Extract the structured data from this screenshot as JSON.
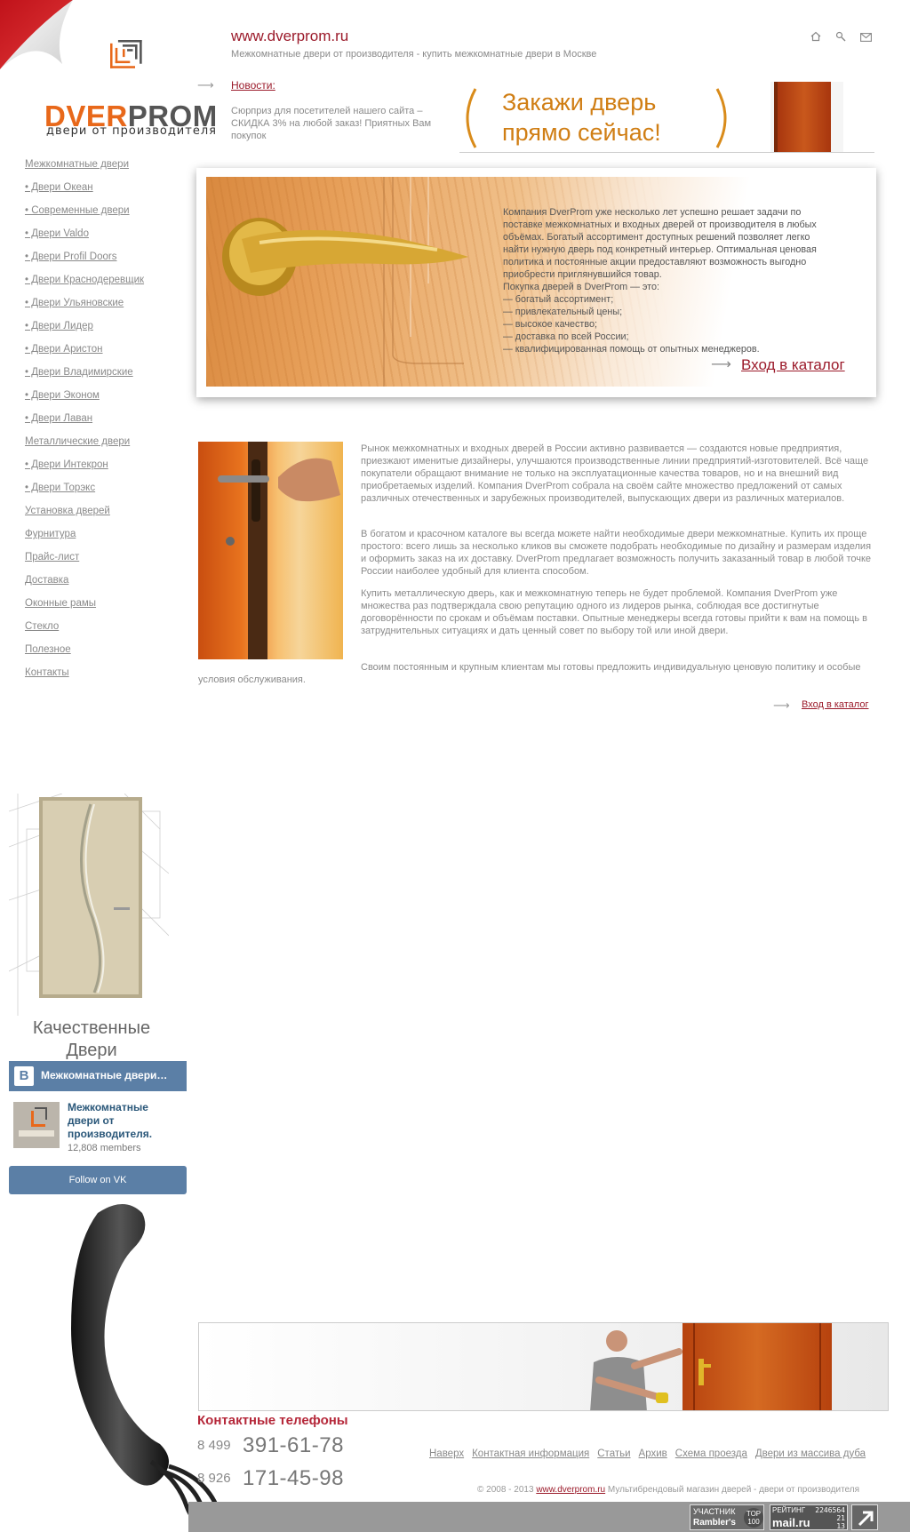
{
  "header": {
    "site_url": "www.dverprom.ru",
    "tagline": "Межкомнатные двери от производителя - купить межкомнатные двери в Москве",
    "icons": [
      "home-icon",
      "search-icon",
      "mail-icon"
    ]
  },
  "logo": {
    "brand_prefix": "DVER",
    "brand_suffix": "PROM",
    "subtitle": "двери от производителя",
    "accent_color": "#e8681a"
  },
  "news": {
    "arrow": "⟶",
    "link_label": "Новости:",
    "text": "Сюрприз для посетителей нашего сайта – СКИДКА 3% на любой заказ! Приятных Вам покупок"
  },
  "banner_top": {
    "line1": "Закажи дверь",
    "line2": "прямо сейчас!"
  },
  "left_nav": [
    "Межкомнатные двери",
    "• Двери Океан",
    "• Современные двери",
    "• Двери Valdo",
    "• Двери Profil Doors",
    "• Двери Краснодеревщик",
    "• Двери Ульяновские",
    "• Двери Лидер",
    "• Двери Аристон",
    "• Двери Владимирские",
    "• Двери Эконом",
    "• Двери Лаван",
    "Металлические двери",
    "• Двери Интекрон",
    "• Двери Торэкс",
    "Установка дверей",
    "Фурнитура",
    "Прайс-лист",
    "Доставка",
    "Оконные рамы",
    "Стекло",
    "Полезное",
    "Контакты"
  ],
  "hero": {
    "lines": [
      "Компания DverProm уже несколько лет успешно решает задачи по",
      "поставке межкомнатных и входных дверей от производителя в любых",
      "объёмах. Богатый ассортимент доступных решений позволяет легко",
      "найти нужную дверь под конкретный интерьер. Оптимальная ценовая",
      "политика и постоянные акции предоставляют возможность выгодно",
      "приобрести приглянувшийся товар.",
      "Покупка дверей в DverProm — это:",
      "— богатый ассортимент;",
      "— привлекательный цены;",
      "— высокое качество;",
      "— доставка по всей России;",
      "— квалифицированная помощь от опытных менеджеров."
    ],
    "cta_arrow": "⟶",
    "cta_label": "Вход в каталог"
  },
  "article": {
    "p1": "Рынок межкомнатных и входных дверей в России активно развивается — создаются новые предприятия, приезжают именитые дизайнеры, улучшаются производственные линии предприятий-изготовителей. Всё чаще покупатели обращают внимание не только на эксплуатационные качества товаров, но и на внешний вид приобретаемых изделий. Компания DverProm собрала на своём сайте множество предложений от самых различных отечественных и зарубежных производителей, выпускающих двери из различных материалов.",
    "p2": "В богатом и красочном каталоге вы всегда можете найти необходимые двери межкомнатные. Купить их проще простого: всего лишь за несколько кликов вы сможете подобрать необходимые по дизайну и размерам изделия и оформить заказ на их доставку. DverProm предлагает возможность получить заказанный товар в любой точке России наиболее удобный для клиента способом.",
    "p3": "Купить металлическую дверь, как и межкомнатную теперь не будет проблемой. Компания DverProm уже множества раз подтверждала свою репутацию одного из лидеров рынка, соблюдая все достигнутые договорённости по срокам и объёмам поставки. Опытные менеджеры всегда готовы прийти к вам на помощь в затруднительных ситуациях и дать ценный совет по выбору той или иной двери.",
    "p4": "Своим постоянным и крупным клиентам мы готовы предложить индивидуальную ценовую политику и особые условия обслуживания.",
    "cta_arrow": "⟶",
    "cta_label": "Вход в каталог"
  },
  "door_ad": {
    "title_line1": "Качественные",
    "title_line2": "Двери"
  },
  "vk_widget": {
    "logo": "В",
    "header": "Межкомнатные двери…",
    "group_name": "Межкомнатные двери от производителя.",
    "members": "12,808 members",
    "follow": "Follow on VK",
    "brand_color": "#5b7fa6"
  },
  "contacts": {
    "title": "Контактные телефоны",
    "phone1_code": "8 499",
    "phone1_number": "391-61-78",
    "phone2_code": "8 926",
    "phone2_number": "171-45-98",
    "title_color": "#b5283a"
  },
  "footer": {
    "links": [
      "Наверх",
      "Контактная информация",
      "Статьи",
      "Архив",
      "Схема проезда",
      "Двери из массива дуба"
    ],
    "copyright_prefix": "© 2008 - 2013",
    "copyright_link": "www.dverprom.ru",
    "copyright_suffix": "Мультибрендовый магазин дверей - двери от производителя"
  },
  "counters": {
    "rambler_line1": "УЧАСТНИК",
    "rambler_line2": "Rambler's",
    "rambler_badge": "TOP 100",
    "mail_label": "РЕЙТИНГ",
    "mail_brand": "mail.ru",
    "mail_numbers": [
      "2246564",
      "21",
      "13"
    ]
  }
}
